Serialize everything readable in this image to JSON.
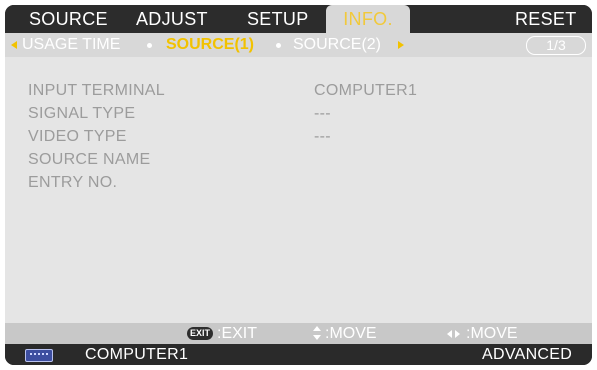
{
  "menu": {
    "tabs": [
      {
        "label": "SOURCE"
      },
      {
        "label": "ADJUST"
      },
      {
        "label": "SETUP"
      },
      {
        "label": "INFO."
      },
      {
        "label": "RESET"
      }
    ],
    "selected": "INFO."
  },
  "subtabs": {
    "items": [
      {
        "label": "USAGE TIME"
      },
      {
        "label": "SOURCE(1)"
      },
      {
        "label": "SOURCE(2)"
      }
    ],
    "selected": "SOURCE(1)",
    "page_indicator": "1/3"
  },
  "info_rows": [
    {
      "label": "INPUT TERMINAL",
      "value": "COMPUTER1"
    },
    {
      "label": "SIGNAL TYPE",
      "value": "---"
    },
    {
      "label": "VIDEO TYPE",
      "value": "---"
    },
    {
      "label": "SOURCE NAME",
      "value": ""
    },
    {
      "label": "ENTRY NO.",
      "value": ""
    }
  ],
  "guide": {
    "exit_key": "EXIT",
    "exit_label": ":EXIT",
    "move_vertical_label": ":MOVE",
    "move_horizontal_label": ":MOVE"
  },
  "status": {
    "source_icon": "computer-connector-icon",
    "source": "COMPUTER1",
    "mode": "ADVANCED"
  },
  "colors": {
    "accent": "#f2c200",
    "connector": "#3d4ea0"
  }
}
